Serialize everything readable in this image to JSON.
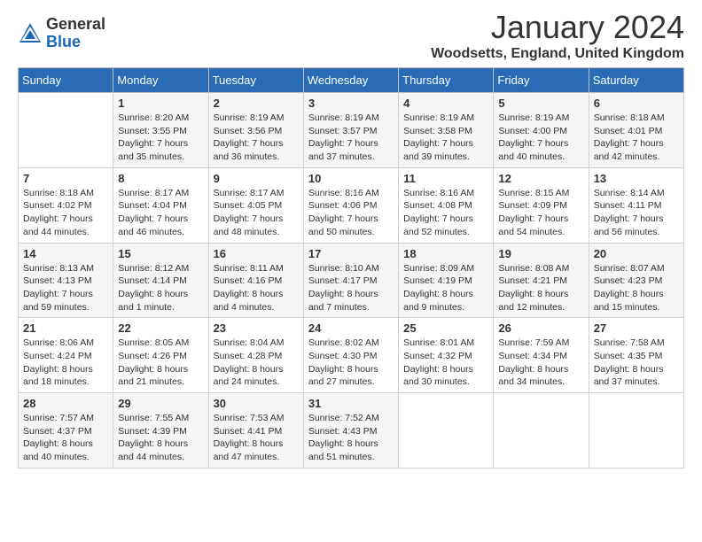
{
  "header": {
    "logo_general": "General",
    "logo_blue": "Blue",
    "title": "January 2024",
    "subtitle": "Woodsetts, England, United Kingdom"
  },
  "weekdays": [
    "Sunday",
    "Monday",
    "Tuesday",
    "Wednesday",
    "Thursday",
    "Friday",
    "Saturday"
  ],
  "weeks": [
    [
      {
        "day": "",
        "sunrise": "",
        "sunset": "",
        "daylight": ""
      },
      {
        "day": "1",
        "sunrise": "Sunrise: 8:20 AM",
        "sunset": "Sunset: 3:55 PM",
        "daylight": "Daylight: 7 hours and 35 minutes."
      },
      {
        "day": "2",
        "sunrise": "Sunrise: 8:19 AM",
        "sunset": "Sunset: 3:56 PM",
        "daylight": "Daylight: 7 hours and 36 minutes."
      },
      {
        "day": "3",
        "sunrise": "Sunrise: 8:19 AM",
        "sunset": "Sunset: 3:57 PM",
        "daylight": "Daylight: 7 hours and 37 minutes."
      },
      {
        "day": "4",
        "sunrise": "Sunrise: 8:19 AM",
        "sunset": "Sunset: 3:58 PM",
        "daylight": "Daylight: 7 hours and 39 minutes."
      },
      {
        "day": "5",
        "sunrise": "Sunrise: 8:19 AM",
        "sunset": "Sunset: 4:00 PM",
        "daylight": "Daylight: 7 hours and 40 minutes."
      },
      {
        "day": "6",
        "sunrise": "Sunrise: 8:18 AM",
        "sunset": "Sunset: 4:01 PM",
        "daylight": "Daylight: 7 hours and 42 minutes."
      }
    ],
    [
      {
        "day": "7",
        "sunrise": "Sunrise: 8:18 AM",
        "sunset": "Sunset: 4:02 PM",
        "daylight": "Daylight: 7 hours and 44 minutes."
      },
      {
        "day": "8",
        "sunrise": "Sunrise: 8:17 AM",
        "sunset": "Sunset: 4:04 PM",
        "daylight": "Daylight: 7 hours and 46 minutes."
      },
      {
        "day": "9",
        "sunrise": "Sunrise: 8:17 AM",
        "sunset": "Sunset: 4:05 PM",
        "daylight": "Daylight: 7 hours and 48 minutes."
      },
      {
        "day": "10",
        "sunrise": "Sunrise: 8:16 AM",
        "sunset": "Sunset: 4:06 PM",
        "daylight": "Daylight: 7 hours and 50 minutes."
      },
      {
        "day": "11",
        "sunrise": "Sunrise: 8:16 AM",
        "sunset": "Sunset: 4:08 PM",
        "daylight": "Daylight: 7 hours and 52 minutes."
      },
      {
        "day": "12",
        "sunrise": "Sunrise: 8:15 AM",
        "sunset": "Sunset: 4:09 PM",
        "daylight": "Daylight: 7 hours and 54 minutes."
      },
      {
        "day": "13",
        "sunrise": "Sunrise: 8:14 AM",
        "sunset": "Sunset: 4:11 PM",
        "daylight": "Daylight: 7 hours and 56 minutes."
      }
    ],
    [
      {
        "day": "14",
        "sunrise": "Sunrise: 8:13 AM",
        "sunset": "Sunset: 4:13 PM",
        "daylight": "Daylight: 7 hours and 59 minutes."
      },
      {
        "day": "15",
        "sunrise": "Sunrise: 8:12 AM",
        "sunset": "Sunset: 4:14 PM",
        "daylight": "Daylight: 8 hours and 1 minute."
      },
      {
        "day": "16",
        "sunrise": "Sunrise: 8:11 AM",
        "sunset": "Sunset: 4:16 PM",
        "daylight": "Daylight: 8 hours and 4 minutes."
      },
      {
        "day": "17",
        "sunrise": "Sunrise: 8:10 AM",
        "sunset": "Sunset: 4:17 PM",
        "daylight": "Daylight: 8 hours and 7 minutes."
      },
      {
        "day": "18",
        "sunrise": "Sunrise: 8:09 AM",
        "sunset": "Sunset: 4:19 PM",
        "daylight": "Daylight: 8 hours and 9 minutes."
      },
      {
        "day": "19",
        "sunrise": "Sunrise: 8:08 AM",
        "sunset": "Sunset: 4:21 PM",
        "daylight": "Daylight: 8 hours and 12 minutes."
      },
      {
        "day": "20",
        "sunrise": "Sunrise: 8:07 AM",
        "sunset": "Sunset: 4:23 PM",
        "daylight": "Daylight: 8 hours and 15 minutes."
      }
    ],
    [
      {
        "day": "21",
        "sunrise": "Sunrise: 8:06 AM",
        "sunset": "Sunset: 4:24 PM",
        "daylight": "Daylight: 8 hours and 18 minutes."
      },
      {
        "day": "22",
        "sunrise": "Sunrise: 8:05 AM",
        "sunset": "Sunset: 4:26 PM",
        "daylight": "Daylight: 8 hours and 21 minutes."
      },
      {
        "day": "23",
        "sunrise": "Sunrise: 8:04 AM",
        "sunset": "Sunset: 4:28 PM",
        "daylight": "Daylight: 8 hours and 24 minutes."
      },
      {
        "day": "24",
        "sunrise": "Sunrise: 8:02 AM",
        "sunset": "Sunset: 4:30 PM",
        "daylight": "Daylight: 8 hours and 27 minutes."
      },
      {
        "day": "25",
        "sunrise": "Sunrise: 8:01 AM",
        "sunset": "Sunset: 4:32 PM",
        "daylight": "Daylight: 8 hours and 30 minutes."
      },
      {
        "day": "26",
        "sunrise": "Sunrise: 7:59 AM",
        "sunset": "Sunset: 4:34 PM",
        "daylight": "Daylight: 8 hours and 34 minutes."
      },
      {
        "day": "27",
        "sunrise": "Sunrise: 7:58 AM",
        "sunset": "Sunset: 4:35 PM",
        "daylight": "Daylight: 8 hours and 37 minutes."
      }
    ],
    [
      {
        "day": "28",
        "sunrise": "Sunrise: 7:57 AM",
        "sunset": "Sunset: 4:37 PM",
        "daylight": "Daylight: 8 hours and 40 minutes."
      },
      {
        "day": "29",
        "sunrise": "Sunrise: 7:55 AM",
        "sunset": "Sunset: 4:39 PM",
        "daylight": "Daylight: 8 hours and 44 minutes."
      },
      {
        "day": "30",
        "sunrise": "Sunrise: 7:53 AM",
        "sunset": "Sunset: 4:41 PM",
        "daylight": "Daylight: 8 hours and 47 minutes."
      },
      {
        "day": "31",
        "sunrise": "Sunrise: 7:52 AM",
        "sunset": "Sunset: 4:43 PM",
        "daylight": "Daylight: 8 hours and 51 minutes."
      },
      {
        "day": "",
        "sunrise": "",
        "sunset": "",
        "daylight": ""
      },
      {
        "day": "",
        "sunrise": "",
        "sunset": "",
        "daylight": ""
      },
      {
        "day": "",
        "sunrise": "",
        "sunset": "",
        "daylight": ""
      }
    ]
  ]
}
